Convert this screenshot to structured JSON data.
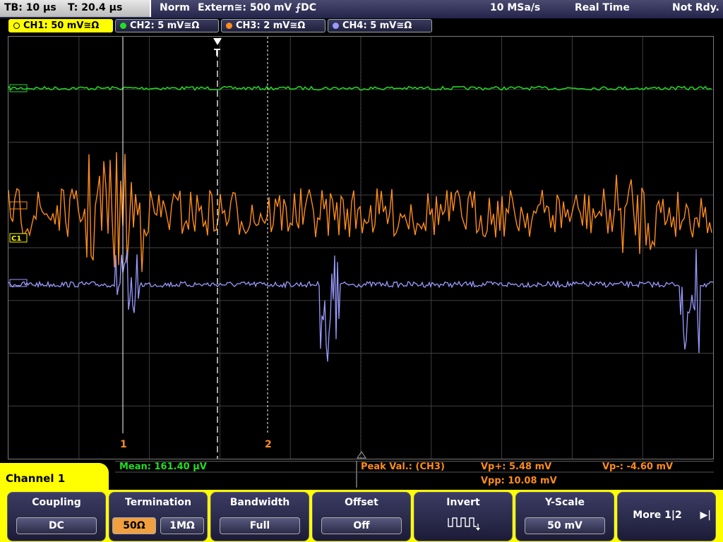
{
  "status_bar": {
    "timebase": "TB: 10 µs",
    "trigger_time": "T: 20.4 µs",
    "mode": "Norm",
    "trigger_source": "Extern≅: 500 mV ⨍DC",
    "sample_rate": "10 MSa/s",
    "acquisition": "Real Time",
    "state": "Not Rdy."
  },
  "channel_tabs": [
    {
      "label": "CH1: 50 mV≅Ω",
      "color": "#ffff00"
    },
    {
      "label": "CH2: 5 mV≅Ω",
      "color": "#22dd22"
    },
    {
      "label": "CH3: 2 mV≅Ω",
      "color": "#ff8c1a"
    },
    {
      "label": "CH4: 5 mV≅Ω",
      "color": "#9a9aff"
    }
  ],
  "markers": {
    "trigger": "T",
    "cursor1": "1",
    "cursor2": "2",
    "ch1_tag": "C1"
  },
  "colors": {
    "ch1": "#ffff00",
    "ch2": "#22dd22",
    "ch3": "#ff8c1a",
    "ch4": "#9a9aff",
    "grid": "#6a6a6a"
  },
  "measurements": {
    "mean": "Mean: 161.40 µV",
    "peak_label": "Peak Val.:  (CH3)",
    "vp_plus": "Vp+: 5.48 mV",
    "vp_minus": "Vp-: -4.60 mV",
    "vpp": "Vpp: 10.08 mV"
  },
  "channel_label": "Channel 1",
  "softkeys": {
    "coupling": {
      "title": "Coupling",
      "value": "DC"
    },
    "termination": {
      "title": "Termination",
      "opt1": "50Ω",
      "opt2": "1MΩ",
      "selected": "50Ω"
    },
    "bandwidth": {
      "title": "Bandwidth",
      "value": "Full"
    },
    "offset": {
      "title": "Offset",
      "value": "Off"
    },
    "invert": {
      "title": "Invert",
      "icon": "inverted-square-wave-icon"
    },
    "yscale": {
      "title": "Y-Scale",
      "value": "50 mV"
    },
    "more": {
      "label": "More 1|2"
    }
  }
}
